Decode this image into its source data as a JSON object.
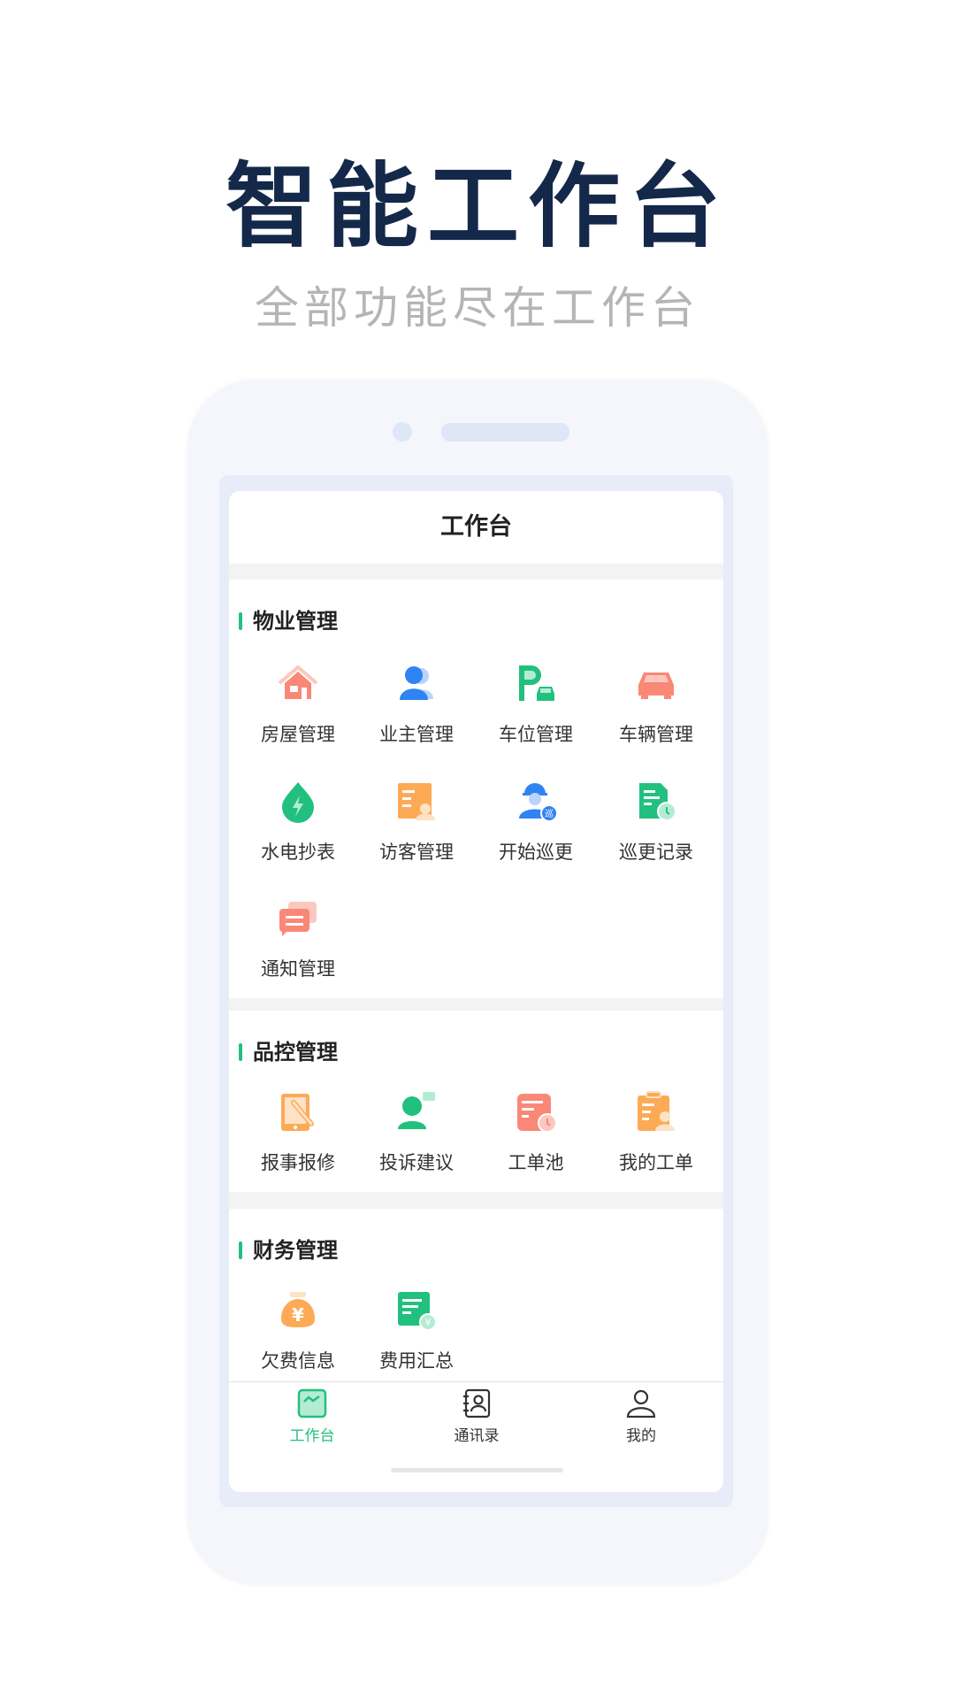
{
  "hero": {
    "title": "智能工作台",
    "subtitle": "全部功能尽在工作台"
  },
  "app": {
    "header_title": "工作台",
    "accent_color": "#22c07f",
    "sections": [
      {
        "title": "物业管理",
        "items": [
          {
            "label": "房屋管理",
            "icon": "house-icon"
          },
          {
            "label": "业主管理",
            "icon": "owner-icon"
          },
          {
            "label": "车位管理",
            "icon": "parking-icon"
          },
          {
            "label": "车辆管理",
            "icon": "car-icon"
          },
          {
            "label": "水电抄表",
            "icon": "utility-drop-icon"
          },
          {
            "label": "访客管理",
            "icon": "visitor-icon"
          },
          {
            "label": "开始巡更",
            "icon": "patrol-guard-icon",
            "badge": "巡"
          },
          {
            "label": "巡更记录",
            "icon": "patrol-record-icon"
          },
          {
            "label": "通知管理",
            "icon": "notice-chat-icon"
          }
        ]
      },
      {
        "title": "品控管理",
        "items": [
          {
            "label": "报事报修",
            "icon": "repair-tablet-icon"
          },
          {
            "label": "投诉建议",
            "icon": "complaint-icon"
          },
          {
            "label": "工单池",
            "icon": "work-order-pool-icon"
          },
          {
            "label": "我的工单",
            "icon": "my-work-order-icon"
          }
        ]
      },
      {
        "title": "财务管理",
        "items": [
          {
            "label": "欠费信息",
            "icon": "money-bag-icon",
            "symbol": "¥"
          },
          {
            "label": "费用汇总",
            "icon": "fee-summary-icon",
            "symbol": "¥"
          }
        ]
      }
    ],
    "tabs": [
      {
        "label": "工作台",
        "icon": "workbench-icon",
        "active": true
      },
      {
        "label": "通讯录",
        "icon": "contacts-icon",
        "active": false
      },
      {
        "label": "我的",
        "icon": "profile-icon",
        "active": false
      }
    ]
  }
}
